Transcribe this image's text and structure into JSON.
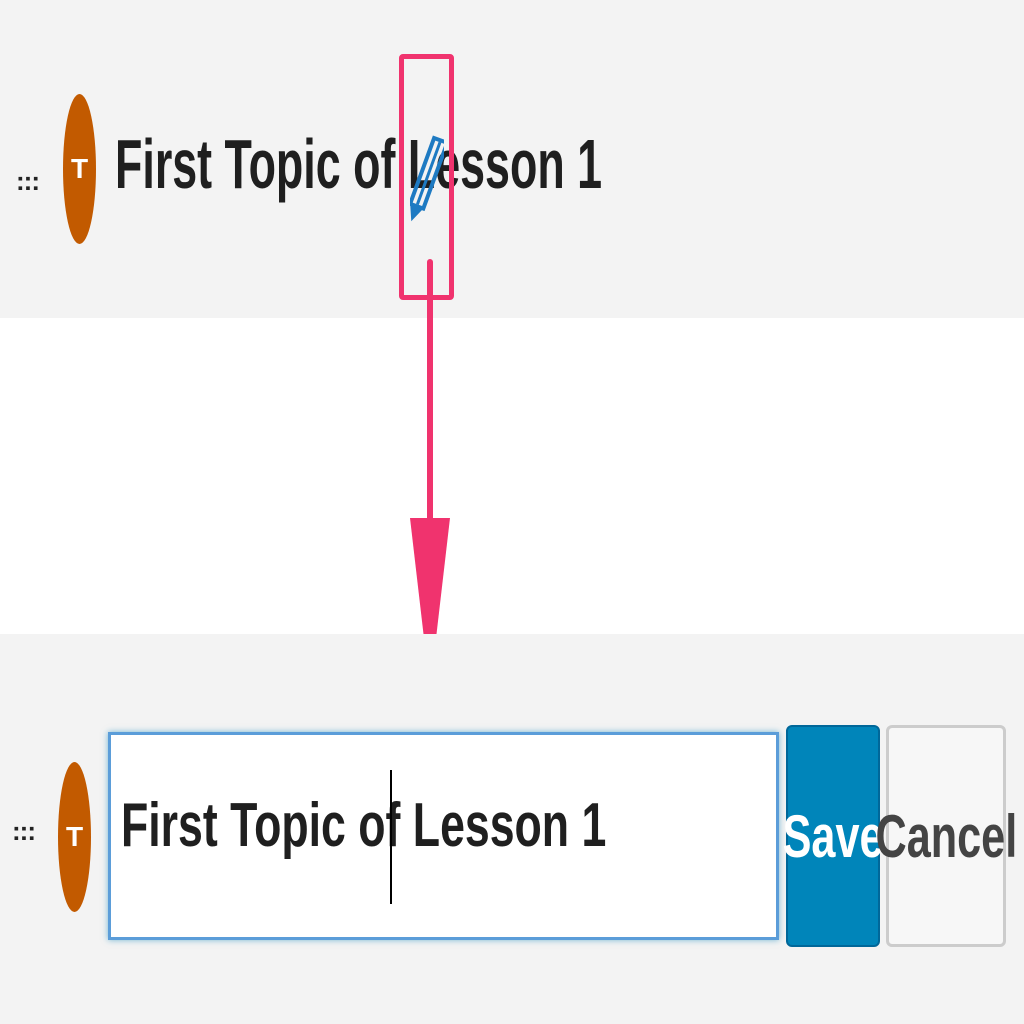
{
  "view_row": {
    "drag_handle": ":::",
    "avatar_letter": "T",
    "title": "First Topic of Lesson 1"
  },
  "edit_row": {
    "drag_handle": ":::",
    "avatar_letter": "T",
    "input_value": "First Topic of Lesson 1",
    "save_label": "Save",
    "cancel_label": "Cancel"
  },
  "colors": {
    "avatar": "#c25a00",
    "highlight": "#f0336e",
    "save_button": "#0085ba",
    "pencil": "#1e7ac2"
  },
  "icons": {
    "edit": "pencil-icon"
  }
}
